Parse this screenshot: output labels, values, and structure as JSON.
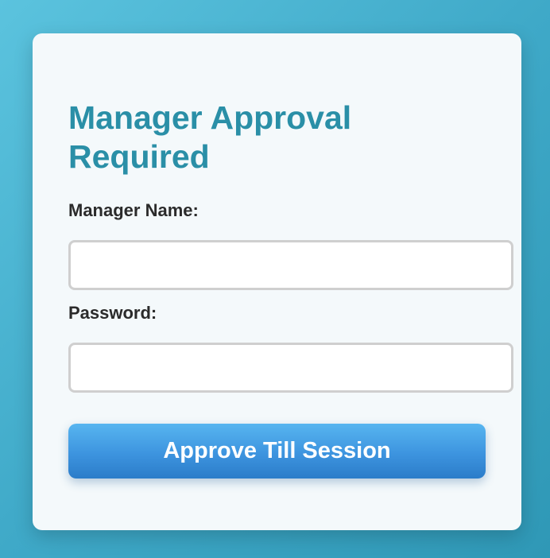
{
  "form": {
    "title": "Manager Approval Required",
    "manager_name_label": "Manager Name:",
    "manager_name_value": "",
    "password_label": "Password:",
    "password_value": "",
    "approve_label": "Approve Till Session"
  },
  "colors": {
    "background_start": "#5bc3de",
    "background_end": "#2f98b6",
    "card": "#f4f9fb",
    "title": "#2a8fa7",
    "button_top": "#57b5f0",
    "button_bottom": "#2b7cc9"
  }
}
